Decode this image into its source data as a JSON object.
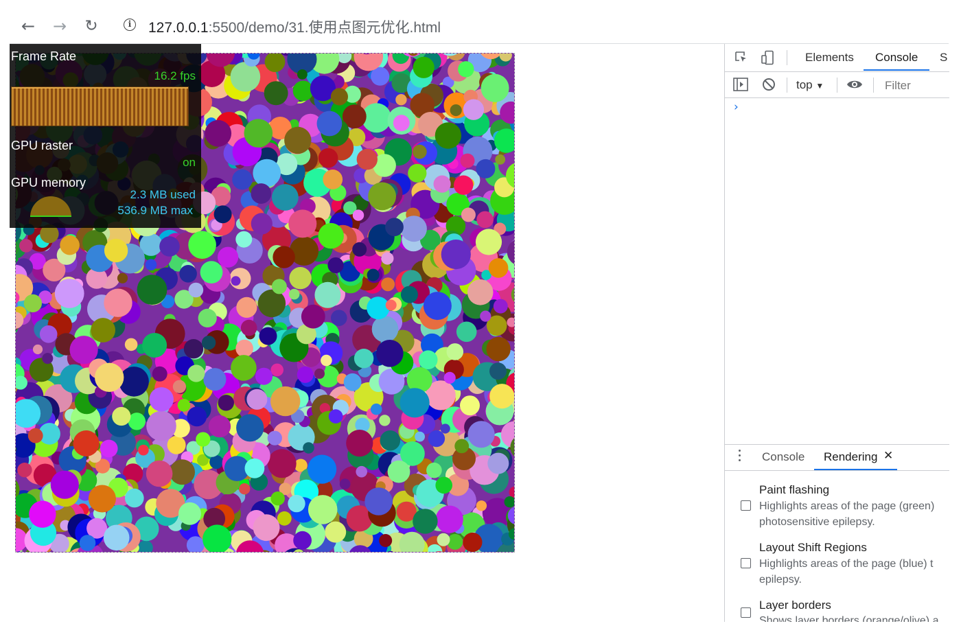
{
  "browser": {
    "url_host": "127.0.0.1",
    "url_path": ":5500/demo/31.使用点图元优化.html"
  },
  "fps_meter": {
    "frame_rate_label": "Frame Rate",
    "fps_value": "16.2 fps",
    "gpu_raster_label": "GPU raster",
    "gpu_raster_value": "on",
    "gpu_memory_label": "GPU memory",
    "gpu_memory_used": "2.3 MB used",
    "gpu_memory_max": "536.9 MB max",
    "colors": {
      "fps": "#38d42a",
      "raster": "#38d42a",
      "memory": "#3ec9f0"
    }
  },
  "devtools": {
    "tabs": [
      "Elements",
      "Console",
      "S"
    ],
    "active_tab": "Console",
    "context_select": "top",
    "filter_placeholder": "Filter",
    "drawer": {
      "tabs": [
        "Console",
        "Rendering"
      ],
      "active_tab": "Rendering",
      "options": [
        {
          "title": "Paint flashing",
          "desc_lines": [
            "Highlights areas of the page (green)",
            "photosensitive epilepsy."
          ],
          "checked": false
        },
        {
          "title": "Layout Shift Regions",
          "desc_lines": [
            "Highlights areas of the page (blue) t",
            "epilepsy."
          ],
          "checked": false
        },
        {
          "title": "Layer borders",
          "desc_lines": [
            "Shows layer borders (orange/olive) a"
          ],
          "checked": false
        }
      ]
    }
  },
  "icons": {
    "back": "arrow-left-icon",
    "forward": "arrow-right-icon",
    "reload": "reload-icon",
    "site_info": "info-icon",
    "inspect": "inspect-element-icon",
    "device": "device-toolbar-icon",
    "sidebar": "sidebar-toggle-icon",
    "clear": "clear-console-icon",
    "eye": "live-expression-icon",
    "prompt": "console-prompt-icon",
    "menu": "more-vertical-icon",
    "close": "close-icon"
  }
}
